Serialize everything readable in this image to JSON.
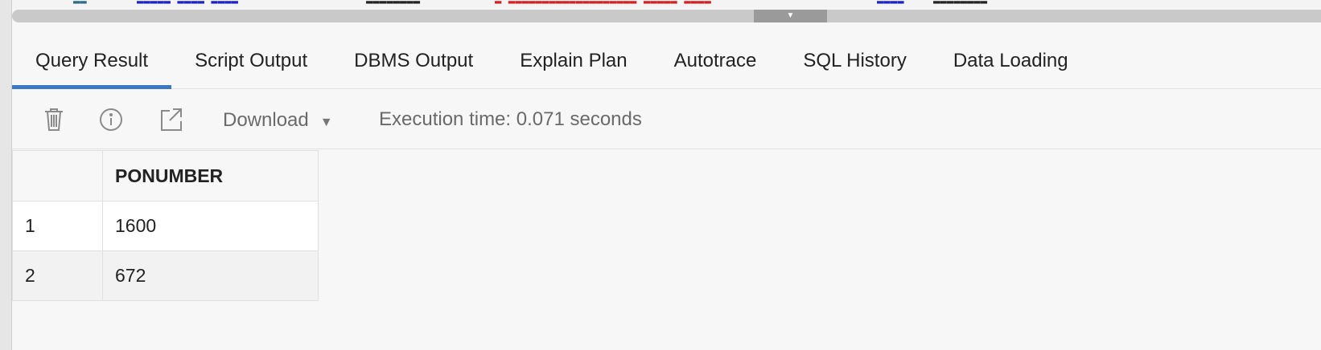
{
  "tabs": [
    {
      "label": "Query Result",
      "active": true
    },
    {
      "label": "Script Output"
    },
    {
      "label": "DBMS Output"
    },
    {
      "label": "Explain Plan"
    },
    {
      "label": "Autotrace"
    },
    {
      "label": "SQL History"
    },
    {
      "label": "Data Loading"
    }
  ],
  "toolbar": {
    "icons": [
      "trash-icon",
      "info-icon",
      "external-link-icon"
    ],
    "download_label": "Download",
    "execution_time": "Execution time: 0.071 seconds"
  },
  "results": {
    "columns": [
      "PONUMBER"
    ],
    "rows": [
      {
        "index": "1",
        "ponumber": "1600"
      },
      {
        "index": "2",
        "ponumber": "672"
      }
    ]
  },
  "colors": {
    "accent": "#3a78c2"
  }
}
